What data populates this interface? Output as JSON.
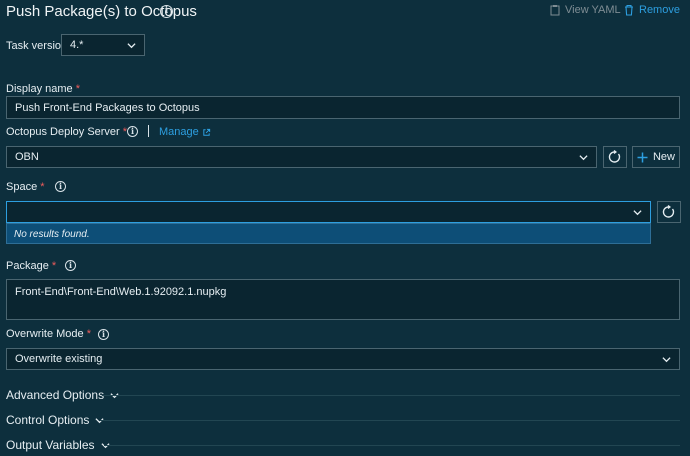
{
  "header": {
    "title": "Push Package(s) to Octopus",
    "view_yaml": "View YAML",
    "remove": "Remove"
  },
  "task_version": {
    "label": "Task version",
    "value": "4.*"
  },
  "display_name": {
    "label": "Display name",
    "required": "*",
    "value": "Push Front-End Packages to Octopus"
  },
  "server": {
    "label": "Octopus Deploy Server",
    "required": "*",
    "manage": "Manage",
    "value": "OBN",
    "new_label": "New"
  },
  "space": {
    "label": "Space",
    "required": "*",
    "value": "",
    "dropdown_message": "No results found."
  },
  "package": {
    "label": "Package",
    "required": "*",
    "value": "Front-End\\Front-End\\Web.1.92092.1.nupkg"
  },
  "overwrite": {
    "label": "Overwrite Mode",
    "required": "*",
    "value": "Overwrite existing"
  },
  "sections": {
    "advanced": "Advanced Options",
    "control": "Control Options",
    "output": "Output Variables"
  },
  "colors": {
    "background": "#0d2f3d",
    "accent": "#2d9fe0",
    "required": "#f05c5c",
    "dropdown_highlight": "#0d4e77"
  }
}
